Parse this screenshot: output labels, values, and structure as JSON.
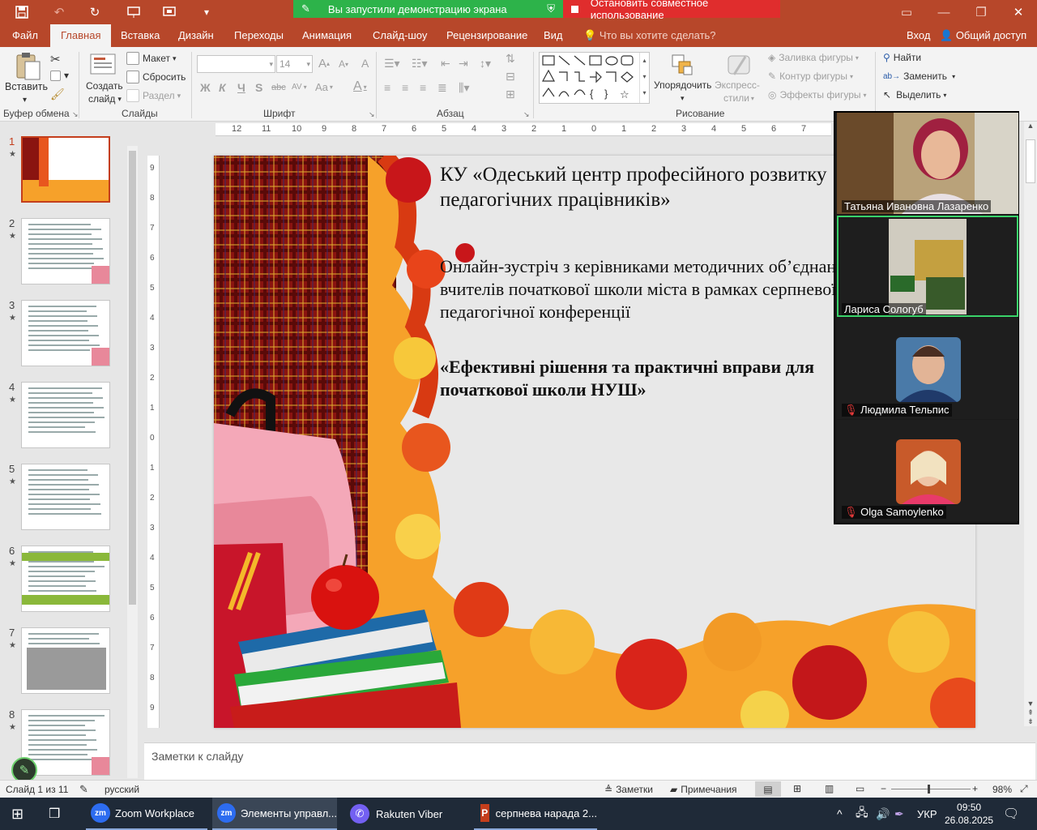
{
  "share_banner": {
    "presenting": "Вы запустили демонстрацию экрана",
    "stop": "Остановить совместное использование"
  },
  "tabs": [
    "Файл",
    "Главная",
    "Вставка",
    "Дизайн",
    "Переходы",
    "Анимация",
    "Слайд-шоу",
    "Рецензирование",
    "Вид"
  ],
  "tell_me": "Что вы хотите сделать?",
  "signin": "Вход",
  "share": "Общий доступ",
  "ribbon": {
    "clipboard": {
      "paste": "Вставить",
      "label": "Буфер обмена"
    },
    "slides": {
      "new_slide_1": "Создать",
      "new_slide_2": "слайд",
      "layout": "Макет",
      "reset": "Сбросить",
      "section": "Раздел",
      "label": "Слайды"
    },
    "font": {
      "size": "14",
      "bold": "Ж",
      "italic": "К",
      "underline": "Ч",
      "shadow": "S",
      "strike": "abc",
      "spacing": "AV",
      "case": "Aa",
      "color": "A",
      "grow": "A",
      "shrink": "A",
      "clear": "A",
      "label": "Шрифт"
    },
    "paragraph": {
      "label": "Абзац"
    },
    "drawing": {
      "arrange_1": "Упорядочить",
      "express_1": "Экспресс-",
      "express_2": "стили",
      "fill": "Заливка фигуры",
      "outline": "Контур фигуры",
      "effects": "Эффекты фигуры",
      "label": "Рисование"
    },
    "editing": {
      "find": "Найти",
      "replace": "Заменить",
      "select": "Выделить",
      "label": "Редактирование"
    }
  },
  "ruler_h": [
    "12",
    "11",
    "10",
    "9",
    "8",
    "7",
    "6",
    "5",
    "4",
    "3",
    "2",
    "1",
    "0",
    "1",
    "2",
    "3",
    "4",
    "5",
    "6",
    "7"
  ],
  "ruler_v": [
    "9",
    "8",
    "7",
    "6",
    "5",
    "4",
    "3",
    "2",
    "1",
    "0",
    "1",
    "2",
    "3",
    "4",
    "5",
    "6",
    "7",
    "8",
    "9"
  ],
  "slides": [
    "1",
    "2",
    "3",
    "4",
    "5",
    "6",
    "7",
    "8"
  ],
  "slide": {
    "line1": "КУ «Одеський  центр  професійного розвитку",
    "line2": "педагогічних  працівників»",
    "line3": "Онлайн-зустріч  з керівниками методичних об’єднань",
    "line4": "вчителів  початкової школи міста в рамках серпневої",
    "line5": "педагогічної конференції",
    "line6": "«Ефективні  рішення  та  практичні  вправи  для",
    "line7": "початкової  школи   НУШ»"
  },
  "notes_placeholder": "Заметки к слайду",
  "status": {
    "slide": "Слайд 1 из 11",
    "lang": "русский",
    "notes": "Заметки",
    "comments": "Примечания",
    "zoom": "98%"
  },
  "participants": [
    {
      "name": "Татьяна Ивановна Лазаренко",
      "muted": false
    },
    {
      "name": "Лариса Сологуб",
      "muted": false
    },
    {
      "name": "Людмила Тельпис",
      "muted": true
    },
    {
      "name": "Olga Samoylenko",
      "muted": true
    }
  ],
  "taskbar": {
    "apps": [
      "Zoom Workplace",
      "Элементы управл...",
      "Rakuten Viber",
      "серпнева нарада 2..."
    ],
    "lang": "УКР",
    "time": "09:50",
    "date": "26.08.2025"
  }
}
